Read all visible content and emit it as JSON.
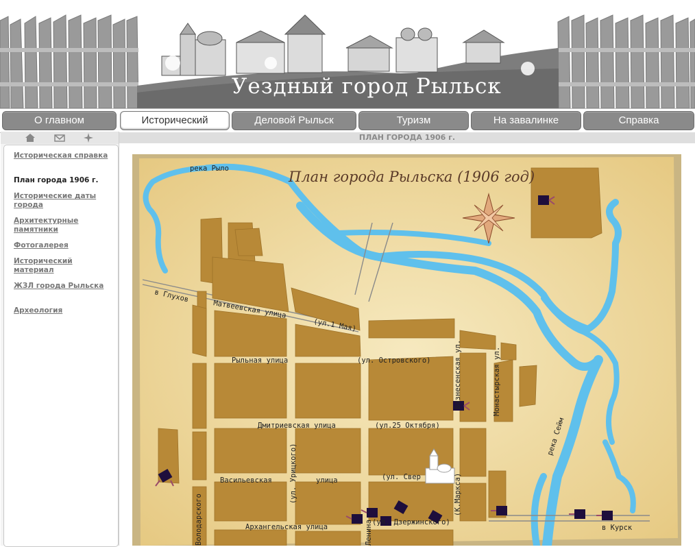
{
  "site": {
    "title": "Уездный город Рыльск"
  },
  "nav": {
    "items": [
      {
        "label": "О главном"
      },
      {
        "label": "Исторический"
      },
      {
        "label": "Деловой Рыльск"
      },
      {
        "label": "Туризм"
      },
      {
        "label": "На завалинке"
      },
      {
        "label": "Справка"
      }
    ],
    "active": "Исторический"
  },
  "sidebar": {
    "icons": [
      "home-icon",
      "mail-icon",
      "sitemap-icon"
    ],
    "items": [
      {
        "label": "Историческая справка"
      },
      {
        "label": "План города 1906 г."
      },
      {
        "label": "Исторические даты города"
      },
      {
        "label": "Архитектурные памятники"
      },
      {
        "label": "Фотогалерея"
      },
      {
        "label": "Исторический материал"
      },
      {
        "label": "ЖЗЛ города Рыльска"
      },
      {
        "label": "Археология"
      }
    ],
    "current": "План города 1906 г."
  },
  "content": {
    "heading": "ПЛАН ГОРОДА 1906 г."
  },
  "map": {
    "title": "План города Рыльска (1906 год)",
    "rivers": [
      "река Рыло",
      "река Сейм"
    ],
    "roads": [
      "в Глухов",
      "в Курск"
    ],
    "streets": [
      "Матвеевская улица",
      "(ул.1 Мая)",
      "Рыльная улица",
      "(ул. Островского)",
      "Дмитриевская улица",
      "(ул.25 Октября)",
      "Васильевская",
      "улица",
      "(ул. Свер",
      "Архангельская улица",
      "(ул. Дзержинского)",
      "(ул. Урицкого)",
      "(К.Маркса)",
      "Монастырская ул.",
      "Вознесенская ул.",
      "Володарского",
      "Ленина"
    ],
    "colors": {
      "parchment": "#f1dea4",
      "block": "#b88937",
      "water": "#5fc0ec",
      "marker": "#1e0e3c"
    }
  }
}
